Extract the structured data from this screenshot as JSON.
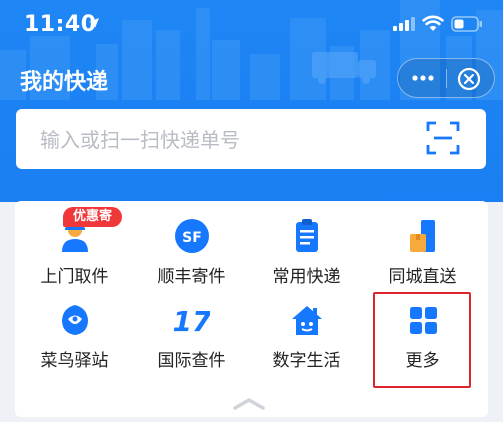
{
  "status_bar": {
    "time": "11:40"
  },
  "header": {
    "title": "我的快递"
  },
  "search": {
    "placeholder": "输入或扫一扫快递单号",
    "value": ""
  },
  "services": {
    "badge": "优惠寄",
    "items": [
      {
        "label": "上门取件",
        "icon": "courier-person-icon"
      },
      {
        "label": "顺丰寄件",
        "icon": "sf-express-icon"
      },
      {
        "label": "常用快递",
        "icon": "clipboard-icon"
      },
      {
        "label": "同城直送",
        "icon": "package-delivery-icon"
      },
      {
        "label": "菜鸟驿站",
        "icon": "cainiao-bird-icon"
      },
      {
        "label": "国际查件",
        "icon": "international-17-icon"
      },
      {
        "label": "数字生活",
        "icon": "digital-home-icon"
      },
      {
        "label": "更多",
        "icon": "grid-more-icon"
      }
    ]
  },
  "colors": {
    "header_blue": "#1a7ff2",
    "icon_blue": "#1677ff",
    "badge_red": "#f0373a",
    "highlight_red": "#e0242b"
  }
}
